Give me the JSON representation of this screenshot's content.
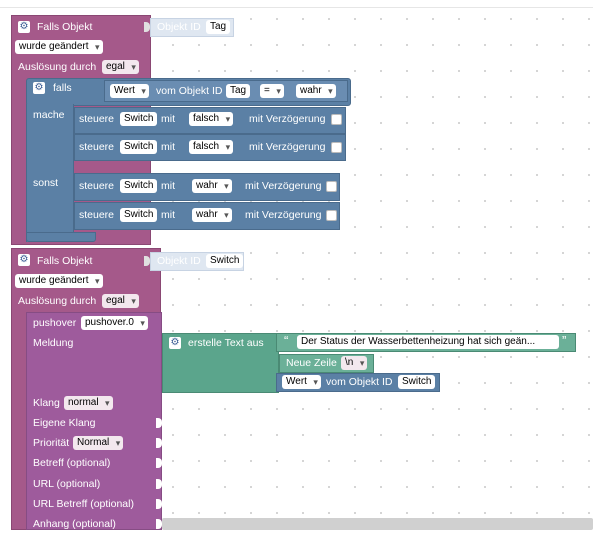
{
  "colors": {
    "event": "#a5598a",
    "logic": "#5b80a5",
    "text": "#5ba58c"
  },
  "icons": {
    "gear": "gear-icon"
  },
  "block1": {
    "title": "Falls Objekt",
    "objekt_label": "Objekt ID",
    "objekt_value": "Tag",
    "trigger": "wurde geändert",
    "ausloesung_label": "Auslösung durch",
    "ausloesung_value": "egal",
    "if": {
      "falls_label": "falls",
      "cond_prop": "Wert",
      "cond_mid": "vom Objekt ID",
      "cond_obj": "Tag",
      "cond_op": "=",
      "cond_val": "wahr",
      "mache_label": "mache",
      "sonst_label": "sonst",
      "steuere_label": "steuere",
      "mit_label": "mit",
      "verz_label": "mit Verzögerung",
      "mache_rows": [
        {
          "target": "Switch",
          "value": "falsch"
        },
        {
          "target": "Switch",
          "value": "falsch"
        }
      ],
      "sonst_rows": [
        {
          "target": "Switch",
          "value": "wahr"
        },
        {
          "target": "Switch",
          "value": "wahr"
        }
      ]
    }
  },
  "block2": {
    "title": "Falls Objekt",
    "objekt_label": "Objekt ID",
    "objekt_value": "Switch",
    "trigger": "wurde geändert",
    "ausloesung_label": "Auslösung durch",
    "ausloesung_value": "egal",
    "pushover": {
      "label": "pushover",
      "instance": "pushover.0",
      "meldung_label": "Meldung",
      "klang_label": "Klang",
      "klang_value": "normal",
      "eigene_klang": "Eigene Klang",
      "prioritaet_label": "Priorität",
      "prioritaet_value": "Normal",
      "betreff": "Betreff (optional)",
      "url": "URL (optional)",
      "url_betreff": "URL Betreff (optional)",
      "anhang": "Anhang (optional)"
    },
    "text": {
      "create_label": "erstelle Text aus",
      "quote_open": "“",
      "quote_close": "”",
      "string1": "Der Status der Wasserbettenheizung hat sich geän...",
      "newline_label": "Neue Zeile",
      "newline_value": "\\n",
      "val_prop": "Wert",
      "val_mid": "vom Objekt ID",
      "val_obj": "Switch"
    }
  }
}
